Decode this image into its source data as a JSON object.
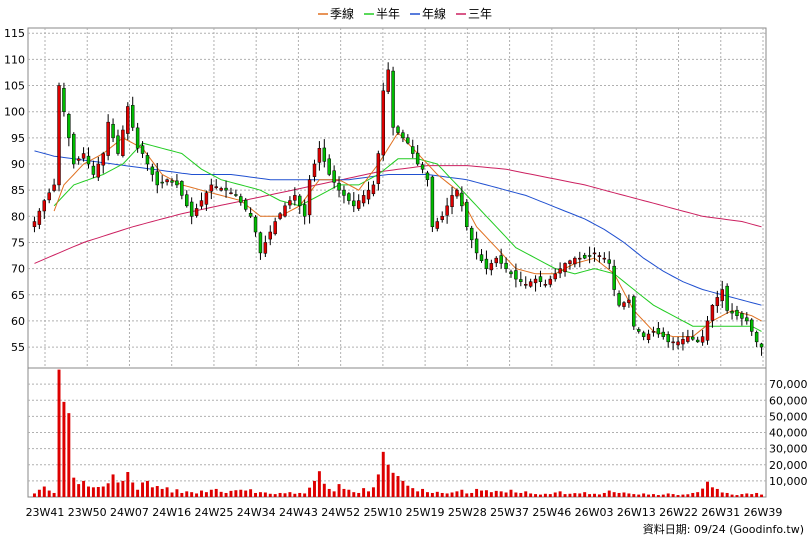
{
  "chart_data": {
    "type": "candlestick",
    "title": "",
    "legend": {
      "placement": "top-center",
      "items": [
        {
          "label": "季線",
          "color": "#e07020"
        },
        {
          "label": "半年",
          "color": "#22cc22"
        },
        {
          "label": "年線",
          "color": "#2050d0"
        },
        {
          "label": "三年",
          "color": "#cc2060"
        }
      ]
    },
    "colors": {
      "up": "#dd0000",
      "down": "#00bb00",
      "volume": "#dd0000",
      "grid": "#b0b0b0"
    },
    "price_axis": {
      "side": "left",
      "ylim": [
        51,
        116
      ],
      "ticks": [
        55,
        60,
        65,
        70,
        75,
        80,
        85,
        90,
        95,
        100,
        105,
        110,
        115
      ]
    },
    "volume_axis": {
      "side": "right",
      "ylim": [
        0,
        80000
      ],
      "ticks": [
        10000,
        20000,
        30000,
        40000,
        50000,
        60000,
        70000
      ],
      "tick_labels": [
        "10,000",
        "20,000",
        "30,000",
        "40,000",
        "50,000",
        "60,000",
        "70,000"
      ]
    },
    "x_labels": [
      "23W41",
      "23W50",
      "24W07",
      "24W16",
      "24W25",
      "24W34",
      "24W43",
      "24W52",
      "25W10",
      "25W19",
      "25W28",
      "25W37",
      "25W46",
      "26W03",
      "26W13",
      "26W22",
      "26W31",
      "26W39"
    ],
    "footnote": "資料日期: 09/24  (Goodinfo.tw)",
    "close_keypoints": [
      [
        0,
        79
      ],
      [
        2,
        83
      ],
      [
        4,
        86
      ],
      [
        5,
        105
      ],
      [
        6,
        100
      ],
      [
        8,
        90
      ],
      [
        10,
        92
      ],
      [
        12,
        88
      ],
      [
        14,
        92
      ],
      [
        15,
        98
      ],
      [
        17,
        92
      ],
      [
        19,
        101
      ],
      [
        21,
        93
      ],
      [
        22,
        92
      ],
      [
        25,
        86
      ],
      [
        27,
        87
      ],
      [
        29,
        86
      ],
      [
        30,
        84
      ],
      [
        32,
        80
      ],
      [
        34,
        83
      ],
      [
        36,
        86
      ],
      [
        39,
        85
      ],
      [
        41,
        84
      ],
      [
        44,
        80
      ],
      [
        45,
        77
      ],
      [
        46,
        73
      ],
      [
        49,
        79
      ],
      [
        51,
        82
      ],
      [
        53,
        84
      ],
      [
        55,
        80
      ],
      [
        56,
        87
      ],
      [
        58,
        93
      ],
      [
        60,
        88
      ],
      [
        62,
        85
      ],
      [
        63,
        84
      ],
      [
        65,
        82
      ],
      [
        67,
        84
      ],
      [
        69,
        86
      ],
      [
        70,
        92
      ],
      [
        71,
        104
      ],
      [
        72,
        108
      ],
      [
        73,
        97
      ],
      [
        74,
        96
      ],
      [
        76,
        94
      ],
      [
        78,
        90
      ],
      [
        79,
        89
      ],
      [
        80,
        87
      ],
      [
        81,
        78
      ],
      [
        83,
        80
      ],
      [
        85,
        84
      ],
      [
        86,
        85
      ],
      [
        87,
        82
      ],
      [
        88,
        78
      ],
      [
        90,
        73
      ],
      [
        92,
        70
      ],
      [
        94,
        72
      ],
      [
        96,
        70
      ],
      [
        98,
        68
      ],
      [
        100,
        67
      ],
      [
        102,
        68
      ],
      [
        104,
        67
      ],
      [
        106,
        69
      ],
      [
        108,
        71
      ],
      [
        110,
        72
      ],
      [
        112,
        72
      ],
      [
        114,
        73
      ],
      [
        116,
        72
      ],
      [
        117,
        71
      ],
      [
        118,
        66
      ],
      [
        119,
        63
      ],
      [
        121,
        64
      ],
      [
        122,
        59
      ],
      [
        124,
        57
      ],
      [
        126,
        58
      ],
      [
        128,
        57
      ],
      [
        129,
        56
      ],
      [
        131,
        56
      ],
      [
        133,
        57
      ],
      [
        135,
        56
      ],
      [
        136,
        57
      ],
      [
        138,
        63
      ],
      [
        140,
        66
      ],
      [
        141,
        62
      ],
      [
        143,
        61
      ],
      [
        145,
        60
      ],
      [
        146,
        58
      ],
      [
        147,
        56
      ],
      [
        148,
        55
      ]
    ],
    "volume_keypoints": [
      [
        0,
        2200
      ],
      [
        1,
        4500
      ],
      [
        2,
        6500
      ],
      [
        3,
        4000
      ],
      [
        4,
        2500
      ],
      [
        5,
        79000
      ],
      [
        6,
        59000
      ],
      [
        7,
        52000
      ],
      [
        8,
        12000
      ],
      [
        9,
        8000
      ],
      [
        10,
        10000
      ],
      [
        11,
        6500
      ],
      [
        12,
        6000
      ],
      [
        13,
        6200
      ],
      [
        14,
        6500
      ],
      [
        15,
        8500
      ],
      [
        16,
        14000
      ],
      [
        17,
        9000
      ],
      [
        18,
        10000
      ],
      [
        19,
        15500
      ],
      [
        20,
        9000
      ],
      [
        21,
        4500
      ],
      [
        22,
        9000
      ],
      [
        23,
        10000
      ],
      [
        24,
        6000
      ],
      [
        25,
        6800
      ],
      [
        26,
        5000
      ],
      [
        27,
        6000
      ],
      [
        28,
        2800
      ],
      [
        29,
        4800
      ],
      [
        30,
        2500
      ],
      [
        31,
        3500
      ],
      [
        32,
        3000
      ],
      [
        33,
        2200
      ],
      [
        34,
        4000
      ],
      [
        35,
        3000
      ],
      [
        36,
        4500
      ],
      [
        37,
        5000
      ],
      [
        38,
        3200
      ],
      [
        39,
        2500
      ],
      [
        40,
        3800
      ],
      [
        41,
        4200
      ],
      [
        42,
        4500
      ],
      [
        43,
        4000
      ],
      [
        44,
        4800
      ],
      [
        45,
        2500
      ],
      [
        46,
        3000
      ],
      [
        47,
        2800
      ],
      [
        48,
        2000
      ],
      [
        49,
        1800
      ],
      [
        50,
        2500
      ],
      [
        51,
        2300
      ],
      [
        52,
        3000
      ],
      [
        53,
        2000
      ],
      [
        54,
        2500
      ],
      [
        55,
        2200
      ],
      [
        56,
        5800
      ],
      [
        57,
        10000
      ],
      [
        58,
        16000
      ],
      [
        59,
        8200
      ],
      [
        60,
        5000
      ],
      [
        61,
        3500
      ],
      [
        62,
        8000
      ],
      [
        63,
        5000
      ],
      [
        64,
        4500
      ],
      [
        65,
        3000
      ],
      [
        66,
        2500
      ],
      [
        67,
        5500
      ],
      [
        68,
        3500
      ],
      [
        69,
        6000
      ],
      [
        70,
        14000
      ],
      [
        71,
        28000
      ],
      [
        72,
        20000
      ],
      [
        73,
        15000
      ],
      [
        74,
        13000
      ],
      [
        75,
        10000
      ],
      [
        76,
        7000
      ],
      [
        77,
        5500
      ],
      [
        78,
        3500
      ],
      [
        79,
        5000
      ],
      [
        80,
        3000
      ],
      [
        81,
        2500
      ],
      [
        82,
        3200
      ],
      [
        83,
        2500
      ],
      [
        84,
        2200
      ],
      [
        85,
        2800
      ],
      [
        86,
        3500
      ],
      [
        87,
        4500
      ],
      [
        88,
        2200
      ],
      [
        89,
        2500
      ],
      [
        90,
        5000
      ],
      [
        91,
        4000
      ],
      [
        92,
        4200
      ],
      [
        93,
        3000
      ],
      [
        94,
        3800
      ],
      [
        95,
        3500
      ],
      [
        96,
        2800
      ],
      [
        97,
        4500
      ],
      [
        98,
        2800
      ],
      [
        99,
        2500
      ],
      [
        100,
        3500
      ],
      [
        101,
        2200
      ],
      [
        102,
        1800
      ],
      [
        103,
        1500
      ],
      [
        104,
        2000
      ],
      [
        105,
        1800
      ],
      [
        106,
        2800
      ],
      [
        107,
        3500
      ],
      [
        108,
        1800
      ],
      [
        109,
        2000
      ],
      [
        110,
        2400
      ],
      [
        111,
        2200
      ],
      [
        112,
        3000
      ],
      [
        113,
        1800
      ],
      [
        114,
        2000
      ],
      [
        115,
        1600
      ],
      [
        116,
        2500
      ],
      [
        117,
        4000
      ],
      [
        118,
        3000
      ],
      [
        119,
        2500
      ],
      [
        120,
        2800
      ],
      [
        121,
        2200
      ],
      [
        122,
        1800
      ],
      [
        123,
        1500
      ],
      [
        124,
        2200
      ],
      [
        125,
        1500
      ],
      [
        126,
        1800
      ],
      [
        127,
        1200
      ],
      [
        128,
        1500
      ],
      [
        129,
        2200
      ],
      [
        130,
        1800
      ],
      [
        131,
        1200
      ],
      [
        132,
        1500
      ],
      [
        133,
        1700
      ],
      [
        134,
        2500
      ],
      [
        135,
        3000
      ],
      [
        136,
        5200
      ],
      [
        137,
        9500
      ],
      [
        138,
        6000
      ],
      [
        139,
        5000
      ],
      [
        140,
        2800
      ],
      [
        141,
        2500
      ],
      [
        142,
        1500
      ],
      [
        143,
        1200
      ],
      [
        144,
        1800
      ],
      [
        145,
        2200
      ],
      [
        146,
        1800
      ],
      [
        147,
        2500
      ],
      [
        148,
        1500
      ]
    ],
    "ma_quarter_keypoints": [
      [
        4,
        81
      ],
      [
        6,
        86
      ],
      [
        10,
        90
      ],
      [
        14,
        92
      ],
      [
        18,
        95
      ],
      [
        22,
        93
      ],
      [
        26,
        88
      ],
      [
        30,
        86
      ],
      [
        34,
        85
      ],
      [
        38,
        84
      ],
      [
        42,
        83
      ],
      [
        46,
        80
      ],
      [
        50,
        80
      ],
      [
        54,
        82
      ],
      [
        58,
        87
      ],
      [
        62,
        87
      ],
      [
        66,
        85
      ],
      [
        70,
        90
      ],
      [
        74,
        96
      ],
      [
        78,
        92
      ],
      [
        82,
        88
      ],
      [
        86,
        85
      ],
      [
        90,
        78
      ],
      [
        94,
        74
      ],
      [
        98,
        70
      ],
      [
        102,
        69
      ],
      [
        106,
        69
      ],
      [
        110,
        71
      ],
      [
        114,
        72
      ],
      [
        118,
        69
      ],
      [
        122,
        62
      ],
      [
        126,
        58
      ],
      [
        130,
        57
      ],
      [
        134,
        57
      ],
      [
        138,
        60
      ],
      [
        142,
        62
      ],
      [
        146,
        61
      ],
      [
        148,
        60
      ]
    ],
    "ma_half_keypoints": [
      [
        4,
        82
      ],
      [
        8,
        86
      ],
      [
        14,
        88
      ],
      [
        18,
        90
      ],
      [
        22,
        94
      ],
      [
        26,
        93
      ],
      [
        30,
        92
      ],
      [
        34,
        89
      ],
      [
        38,
        87
      ],
      [
        42,
        86
      ],
      [
        46,
        85
      ],
      [
        50,
        83
      ],
      [
        54,
        82
      ],
      [
        58,
        84
      ],
      [
        62,
        86
      ],
      [
        66,
        86
      ],
      [
        70,
        88
      ],
      [
        74,
        91
      ],
      [
        78,
        91
      ],
      [
        82,
        90
      ],
      [
        86,
        86
      ],
      [
        90,
        82
      ],
      [
        94,
        78
      ],
      [
        98,
        74
      ],
      [
        102,
        72
      ],
      [
        106,
        70
      ],
      [
        110,
        69
      ],
      [
        114,
        70
      ],
      [
        118,
        69
      ],
      [
        122,
        66
      ],
      [
        126,
        63
      ],
      [
        130,
        61
      ],
      [
        134,
        59
      ],
      [
        138,
        59
      ],
      [
        142,
        59
      ],
      [
        146,
        59
      ],
      [
        148,
        58
      ]
    ],
    "ma_year_keypoints": [
      [
        0,
        92.5
      ],
      [
        4,
        91.5
      ],
      [
        8,
        91
      ],
      [
        12,
        90.5
      ],
      [
        16,
        90
      ],
      [
        20,
        89.5
      ],
      [
        24,
        89
      ],
      [
        28,
        88.5
      ],
      [
        32,
        88
      ],
      [
        36,
        88
      ],
      [
        40,
        88
      ],
      [
        44,
        87.5
      ],
      [
        48,
        87
      ],
      [
        52,
        87
      ],
      [
        56,
        87
      ],
      [
        60,
        87
      ],
      [
        64,
        87
      ],
      [
        68,
        87.5
      ],
      [
        72,
        88
      ],
      [
        76,
        88
      ],
      [
        80,
        88
      ],
      [
        84,
        87.5
      ],
      [
        88,
        87
      ],
      [
        92,
        86
      ],
      [
        96,
        85
      ],
      [
        100,
        84
      ],
      [
        104,
        82.5
      ],
      [
        108,
        81
      ],
      [
        112,
        79.5
      ],
      [
        116,
        77.5
      ],
      [
        120,
        75
      ],
      [
        124,
        72
      ],
      [
        128,
        69.5
      ],
      [
        132,
        67.5
      ],
      [
        136,
        66
      ],
      [
        140,
        65
      ],
      [
        144,
        64
      ],
      [
        148,
        63
      ]
    ],
    "ma_3year_keypoints": [
      [
        0,
        71
      ],
      [
        10,
        75
      ],
      [
        20,
        78
      ],
      [
        30,
        80.5
      ],
      [
        40,
        82.5
      ],
      [
        50,
        84.5
      ],
      [
        60,
        86.5
      ],
      [
        70,
        88.5
      ],
      [
        80,
        89.7
      ],
      [
        88,
        89.7
      ],
      [
        96,
        89
      ],
      [
        104,
        87.5
      ],
      [
        112,
        86
      ],
      [
        120,
        84
      ],
      [
        128,
        82
      ],
      [
        136,
        80
      ],
      [
        144,
        79
      ],
      [
        148,
        78
      ]
    ]
  }
}
